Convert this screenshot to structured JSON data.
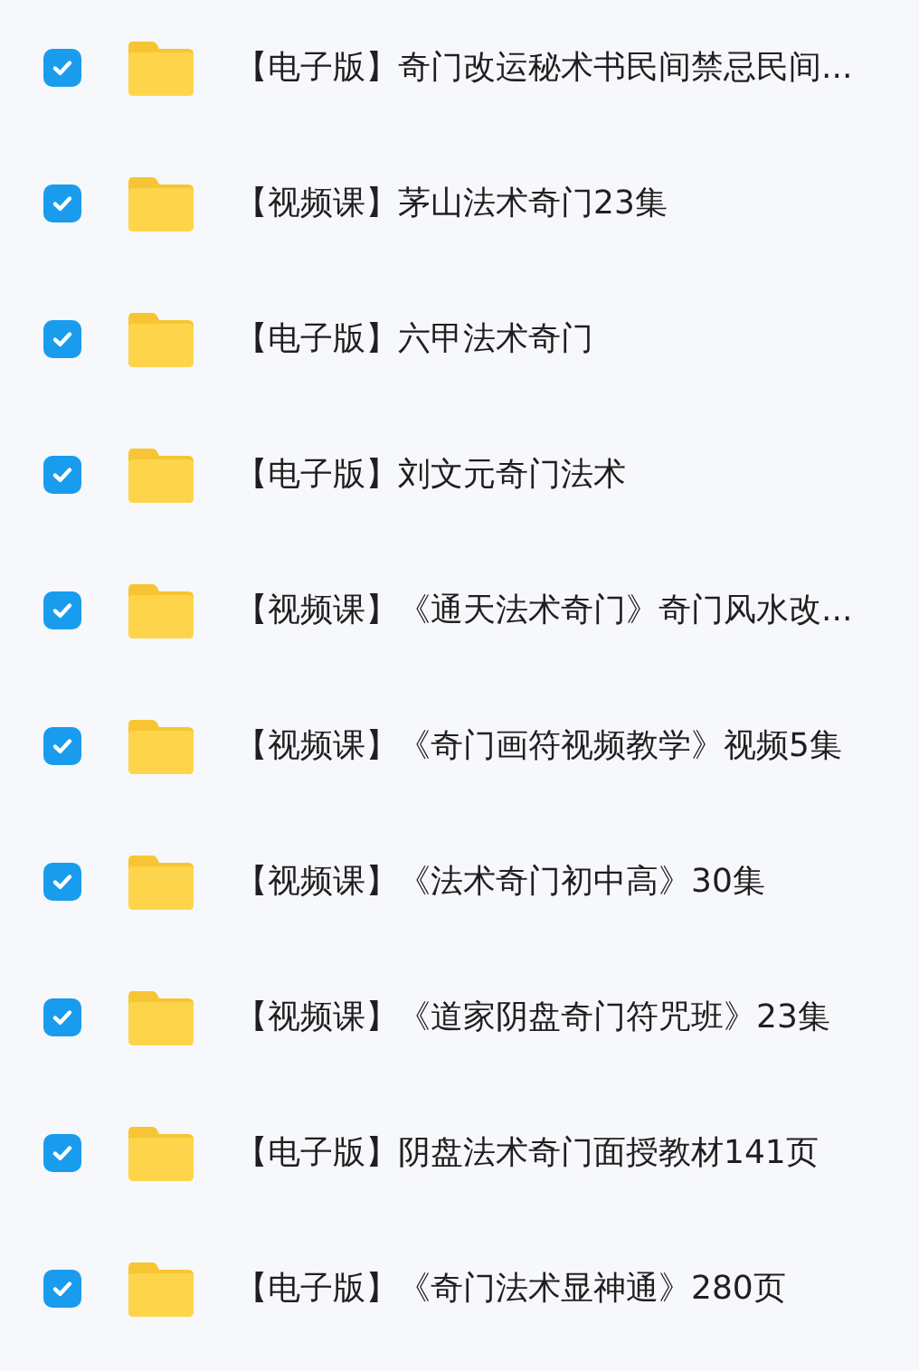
{
  "files": [
    {
      "name": "【电子版】奇门改运秘术书民间禁忌民间...",
      "checked": true
    },
    {
      "name": "【视频课】茅山法术奇门23集",
      "checked": true
    },
    {
      "name": "【电子版】六甲法术奇门",
      "checked": true
    },
    {
      "name": "【电子版】刘文元奇门法术",
      "checked": true
    },
    {
      "name": "【视频课】《通天法术奇门》奇门风水改...",
      "checked": true
    },
    {
      "name": "【视频课】《奇门画符视频教学》视频5集",
      "checked": true
    },
    {
      "name": "【视频课】《法术奇门初中高》30集",
      "checked": true
    },
    {
      "name": "【视频课】《道家阴盘奇门符咒班》23集",
      "checked": true
    },
    {
      "name": "【电子版】阴盘法术奇门面授教材141页",
      "checked": true
    },
    {
      "name": "【电子版】《奇门法术显神通》280页",
      "checked": true
    }
  ]
}
